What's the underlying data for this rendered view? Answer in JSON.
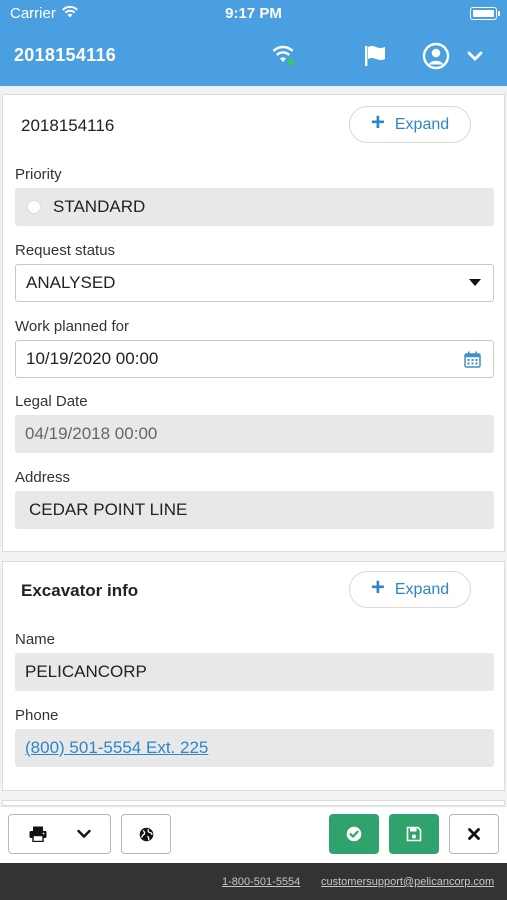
{
  "status_bar": {
    "carrier": "Carrier",
    "time": "9:17 PM"
  },
  "app_bar": {
    "title": "2018154116"
  },
  "request_card": {
    "title": "2018154116",
    "expand_label": "Expand",
    "priority": {
      "label": "Priority",
      "value": "STANDARD"
    },
    "request_status": {
      "label": "Request status",
      "value": "ANALYSED"
    },
    "work_planned_for": {
      "label": "Work planned for",
      "value": "10/19/2020 00:00"
    },
    "legal_date": {
      "label": "Legal Date",
      "value": "04/19/2018 00:00"
    },
    "address": {
      "label": "Address",
      "value": "CEDAR POINT LINE"
    }
  },
  "excavator_card": {
    "title": "Excavator info",
    "expand_label": "Expand",
    "name": {
      "label": "Name",
      "value": "PELICANCORP"
    },
    "phone": {
      "label": "Phone",
      "value": "(800) 501-5554 Ext. 225"
    }
  },
  "footer": {
    "phone": "1-800-501-5554",
    "email": "customersupport@pelicancorp.com"
  },
  "colors": {
    "header": "#4a9fe0",
    "accent": "#2e86c8",
    "save_green": "#2fa36b",
    "footer": "#333333"
  },
  "icons": [
    "wifi-icon",
    "battery-icon",
    "network-status-icon",
    "flag-icon",
    "user-icon",
    "chevron-down-icon",
    "plus-icon",
    "dropdown-caret-icon",
    "calendar-icon",
    "print-icon",
    "globe-icon",
    "check-icon",
    "save-icon",
    "close-icon"
  ]
}
